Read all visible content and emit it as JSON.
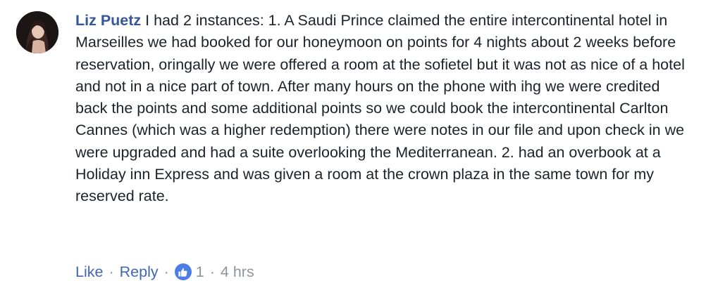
{
  "comment": {
    "author": "Liz Puetz",
    "text": "I had 2 instances: 1. A Saudi Prince claimed the entire intercontinental hotel in Marseilles we had booked for our honeymoon on points for 4 nights about 2 weeks before reservation, oringally we were offered a room at the sofietel but it was not as nice of a hotel and not in a nice part of town. After many hours on the phone with ihg we were credited back the points and some additional points so we could book the intercontinental Carlton Cannes (which was a higher redemption) there were notes in our file and upon check in we were upgraded and had a suite overlooking the Mediterranean. 2. had an overbook at a Holiday inn Express and was given a room at the crown plaza in the same town for my reserved rate.",
    "avatar_icon": "profile-photo"
  },
  "actions": {
    "like_label": "Like",
    "reply_label": "Reply",
    "separator": "·",
    "reaction_icon": "thumbs-up-icon",
    "reaction_count": "1",
    "timestamp": "4 hrs"
  },
  "colors": {
    "author": "#365899",
    "action_link": "#4267b2",
    "meta_gray": "#90949c",
    "body_text": "#1d2129",
    "like_badge": "#4c7ee5"
  }
}
